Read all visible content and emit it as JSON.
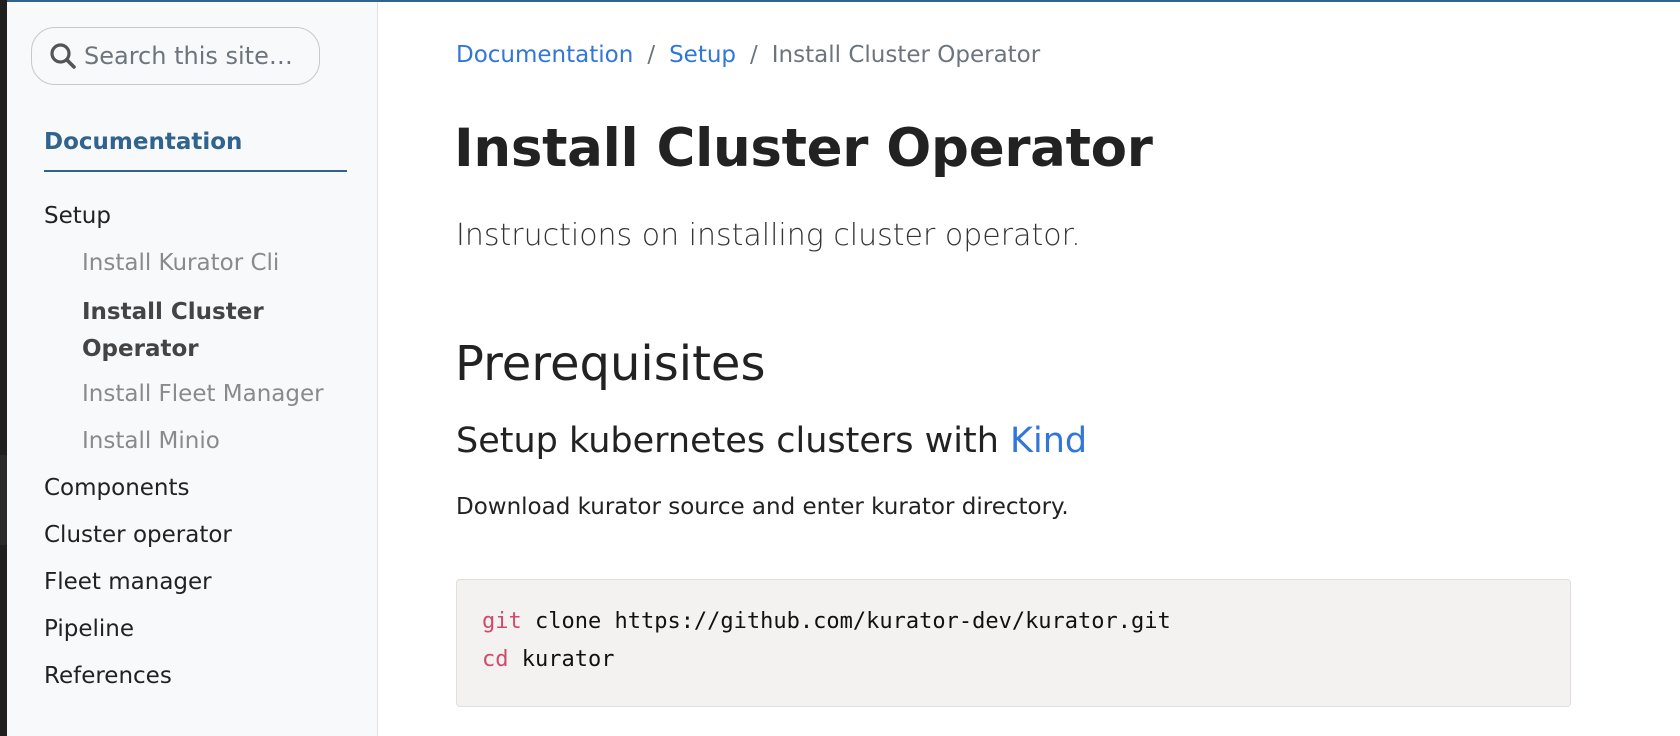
{
  "search": {
    "placeholder": "Search this site…"
  },
  "sidebar": {
    "section_title": "Documentation",
    "items": [
      {
        "label": "Setup"
      },
      {
        "label": "Install Kurator Cli"
      },
      {
        "label": "Install Cluster Operator"
      },
      {
        "label": "Install Fleet Manager"
      },
      {
        "label": "Install Minio"
      },
      {
        "label": "Components"
      },
      {
        "label": "Cluster operator"
      },
      {
        "label": "Fleet manager"
      },
      {
        "label": "Pipeline"
      },
      {
        "label": "References"
      }
    ]
  },
  "breadcrumb": [
    {
      "label": "Documentation"
    },
    {
      "label": "Setup"
    },
    {
      "label": "Install Cluster Operator"
    }
  ],
  "breadcrumb_separator": "/",
  "page": {
    "title": "Install Cluster Operator",
    "lead": "Instructions on installing cluster operator.",
    "h2": "Prerequisites",
    "h3_text": "Setup kubernetes clusters with ",
    "h3_link": "Kind",
    "paragraph": "Download kurator source and enter kurator directory."
  },
  "code": {
    "lines": [
      {
        "cmd": "git",
        "rest": " clone https://github.com/kurator-dev/kurator.git"
      },
      {
        "cmd": "cd",
        "rest": " kurator"
      }
    ]
  },
  "colors": {
    "accent": "#30638e",
    "link": "#3176d9",
    "code_keyword": "#d14a6a",
    "sidebar_bg": "#f8f9fa",
    "code_bg": "#f3f2f1"
  },
  "icons": {
    "search": "magnifier-icon"
  }
}
